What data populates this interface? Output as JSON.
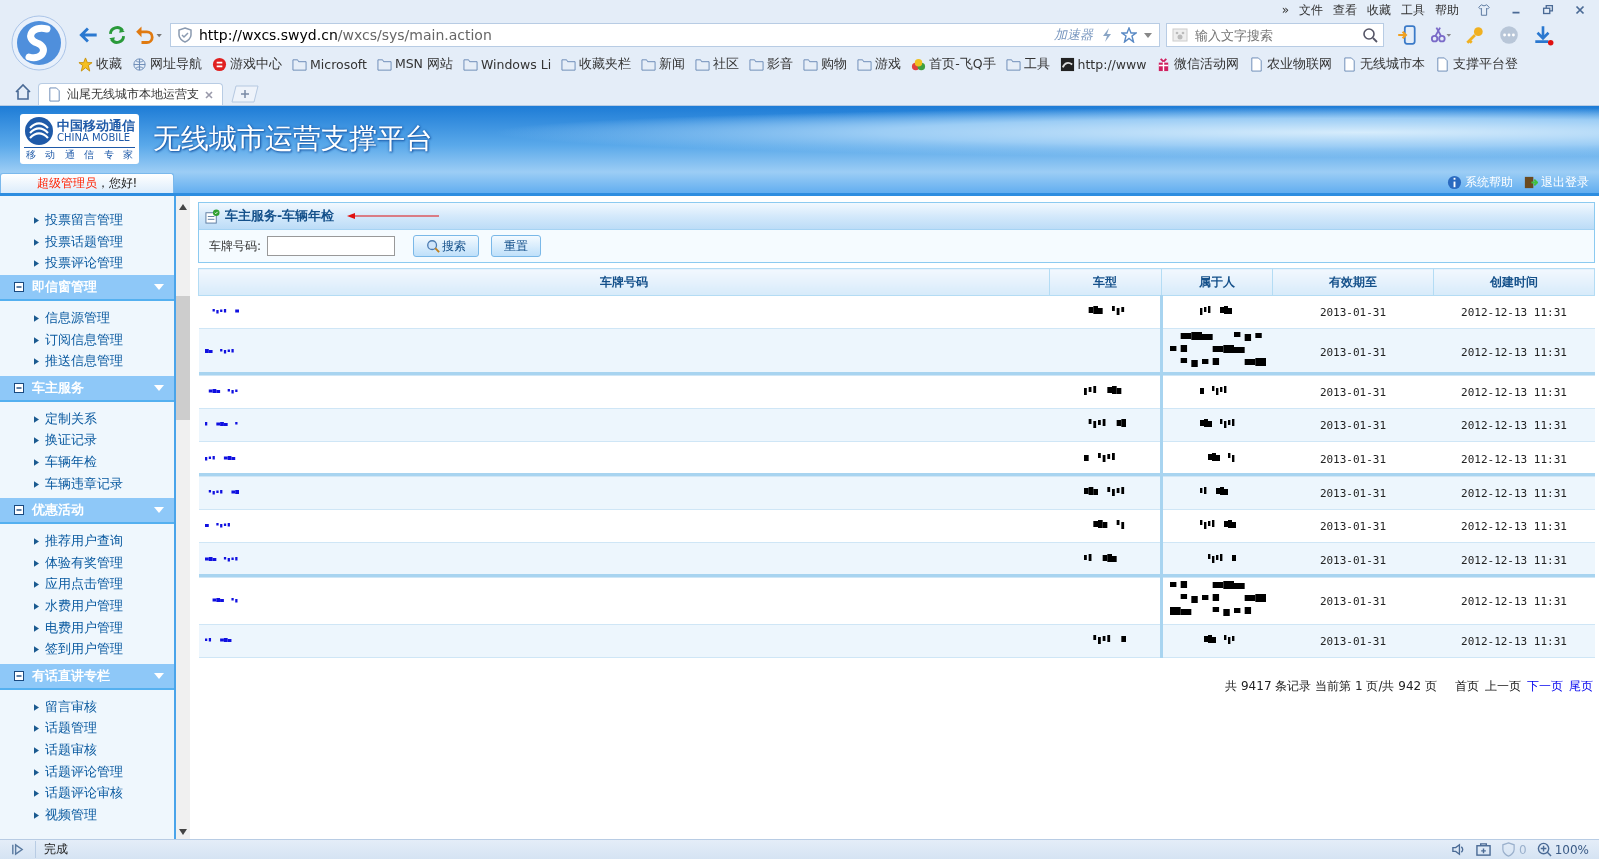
{
  "browser": {
    "menu": [
      "»",
      "文件",
      "查看",
      "收藏",
      "工具",
      "帮助"
    ],
    "address": {
      "host": "http://wxcs.swyd.cn",
      "path": "/wxcs/sys/main.action",
      "accelerator": "加速器"
    },
    "search": {
      "placeholder": "输入文字搜索"
    },
    "bookmarks": [
      {
        "label": "收藏",
        "kind": "star"
      },
      {
        "label": "网址导航",
        "kind": "globe"
      },
      {
        "label": "游戏中心",
        "kind": "game"
      },
      {
        "label": "Microsoft",
        "kind": "folder"
      },
      {
        "label": "MSN 网站",
        "kind": "folder"
      },
      {
        "label": "Windows Li",
        "kind": "folder"
      },
      {
        "label": "收藏夹栏",
        "kind": "folder"
      },
      {
        "label": "新闻",
        "kind": "folder"
      },
      {
        "label": "社区",
        "kind": "folder"
      },
      {
        "label": "影音",
        "kind": "folder"
      },
      {
        "label": "购物",
        "kind": "folder"
      },
      {
        "label": "游戏",
        "kind": "folder"
      },
      {
        "label": "首页-飞Q手",
        "kind": "colorful"
      },
      {
        "label": "工具",
        "kind": "folder"
      },
      {
        "label": "http://www",
        "kind": "dark"
      },
      {
        "label": "微信活动网",
        "kind": "gift"
      },
      {
        "label": "农业物联网",
        "kind": "page"
      },
      {
        "label": "无线城市本",
        "kind": "page"
      },
      {
        "label": "支撑平台登",
        "kind": "page"
      }
    ],
    "tabs": [
      {
        "title": "汕尾无线城市本地运营支",
        "selected": true
      }
    ]
  },
  "header": {
    "logo_cn": "中国移动通信",
    "logo_en": "CHINA MOBILE",
    "logo_slogan": [
      "移",
      "动",
      "通",
      "信",
      "专",
      "家"
    ],
    "title": "无线城市运营支撑平台",
    "links": [
      "系统帮助",
      "退出登录"
    ]
  },
  "welcome": {
    "role": "超级管理员",
    "greeting": "，您好!"
  },
  "sidebar": {
    "loose_items": [
      "投票留言管理",
      "投票话题管理",
      "投票评论管理"
    ],
    "groups": [
      {
        "title": "即信窗管理",
        "expanded": true,
        "items": [
          "信息源管理",
          "订阅信息管理",
          "推送信息管理"
        ]
      },
      {
        "title": "车主服务",
        "expanded": true,
        "items": [
          "定制关系",
          "换证记录",
          "车辆年检",
          "车辆违章记录"
        ]
      },
      {
        "title": "优惠活动",
        "expanded": true,
        "items": [
          "推荐用户查询",
          "体验有奖管理",
          "应用点击管理",
          "水费用户管理",
          "电费用户管理",
          "签到用户管理"
        ]
      },
      {
        "title": "有话直讲专栏",
        "expanded": true,
        "items": [
          "留言审核",
          "话题管理",
          "话题审核",
          "话题评论管理",
          "话题评论审核",
          "视频管理"
        ]
      }
    ]
  },
  "panel": {
    "title": "车主服务-车辆年检",
    "filter_label": "车牌号码:",
    "buttons": [
      "搜索",
      "重置"
    ]
  },
  "table": {
    "columns": [
      "车牌号码",
      "车型",
      "属于人",
      "有效期至",
      "创建时间"
    ],
    "rows": [
      {
        "plate": {
          "kind": "redacted"
        },
        "model": {
          "kind": "redacted"
        },
        "owner": {
          "kind": "redacted"
        },
        "valid_until": "2013-01-31",
        "created": "2012-12-13 11:31",
        "group_end": false
      },
      {
        "plate": {
          "kind": "redacted"
        },
        "owner": {
          "kind": "redacted_multiline"
        },
        "valid_until": "2013-01-31",
        "created": "2012-12-13 11:31",
        "group_end": true
      },
      {
        "plate": {
          "kind": "redacted"
        },
        "model": {
          "kind": "redacted"
        },
        "owner": {
          "kind": "redacted"
        },
        "valid_until": "2013-01-31",
        "created": "2012-12-13 11:31",
        "group_end": false
      },
      {
        "plate": {
          "kind": "redacted"
        },
        "model": {
          "kind": "redacted"
        },
        "owner": {
          "kind": "redacted"
        },
        "valid_until": "2013-01-31",
        "created": "2012-12-13 11:31",
        "group_end": false
      },
      {
        "plate": {
          "kind": "redacted"
        },
        "model": {
          "kind": "redacted"
        },
        "owner": {
          "kind": "redacted"
        },
        "valid_until": "2013-01-31",
        "created": "2012-12-13 11:31",
        "group_end": true
      },
      {
        "plate": {
          "kind": "redacted"
        },
        "model": {
          "kind": "redacted"
        },
        "owner": {
          "kind": "redacted"
        },
        "valid_until": "2013-01-31",
        "created": "2012-12-13 11:31",
        "group_end": false
      },
      {
        "plate": {
          "kind": "redacted"
        },
        "model": {
          "kind": "redacted"
        },
        "owner": {
          "kind": "redacted"
        },
        "valid_until": "2013-01-31",
        "created": "2012-12-13 11:31",
        "group_end": false
      },
      {
        "plate": {
          "kind": "redacted"
        },
        "model": {
          "kind": "redacted"
        },
        "owner": {
          "kind": "redacted"
        },
        "valid_until": "2013-01-31",
        "created": "2012-12-13 11:31",
        "group_end": true
      },
      {
        "plate": {
          "kind": "redacted"
        },
        "owner": {
          "kind": "redacted_multiline"
        },
        "valid_until": "2013-01-31",
        "created": "2012-12-13 11:31",
        "group_end": false
      },
      {
        "plate": {
          "kind": "redacted"
        },
        "model": {
          "kind": "redacted"
        },
        "owner": {
          "kind": "redacted"
        },
        "valid_until": "2013-01-31",
        "created": "2012-12-13 11:31",
        "group_end": false
      }
    ]
  },
  "pagination": {
    "summary": "共 9417 条记录 当前第 1 页/共 942 页",
    "links": [
      {
        "label": "首页",
        "disabled": true
      },
      {
        "label": "上一页",
        "disabled": true
      },
      {
        "label": "下一页",
        "disabled": false
      },
      {
        "label": "尾页",
        "disabled": false
      }
    ]
  },
  "status_bar": {
    "text": "完成",
    "ad_count": "0",
    "zoom": "100%"
  }
}
